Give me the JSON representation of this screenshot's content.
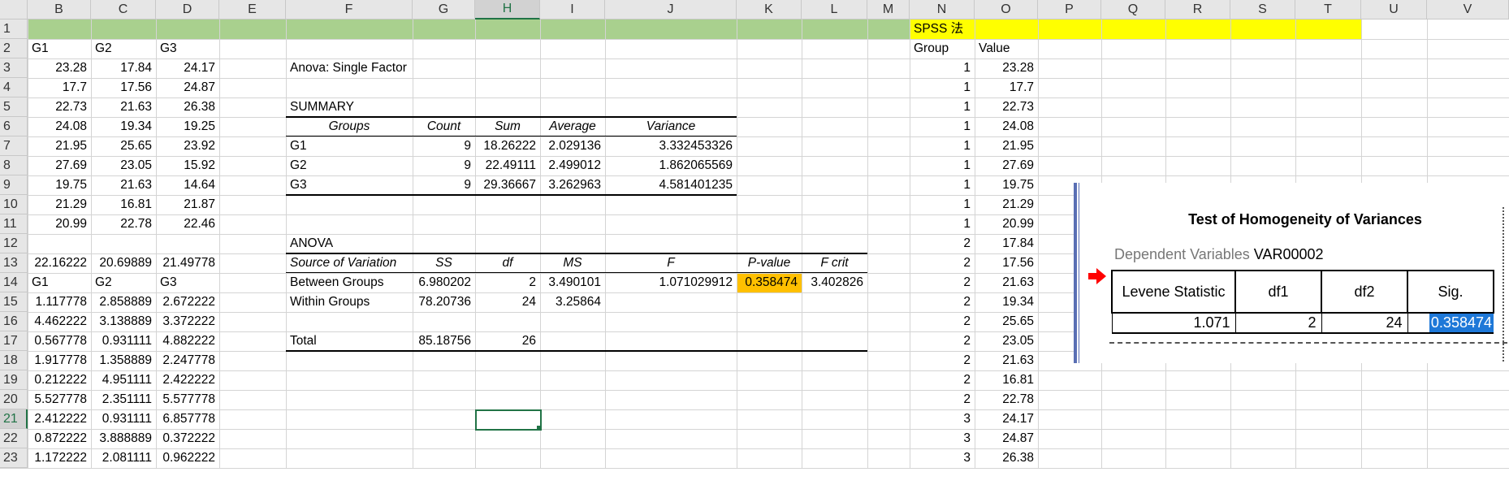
{
  "columns": [
    "B",
    "C",
    "D",
    "E",
    "F",
    "G",
    "H",
    "I",
    "J",
    "K",
    "L",
    "M",
    "N",
    "O",
    "P",
    "Q",
    "R",
    "S",
    "T",
    "U",
    "V"
  ],
  "rows": [
    "1",
    "2",
    "3",
    "4",
    "5",
    "6",
    "7",
    "8",
    "9",
    "10",
    "11",
    "12",
    "13",
    "14",
    "15",
    "16",
    "17",
    "18",
    "19",
    "20",
    "21",
    "22",
    "23"
  ],
  "colors": {
    "green_band": "#a9d08e",
    "yellow_band": "#ffff00",
    "pvalue_fill": "#ffc000",
    "selection": "#217346"
  },
  "cells": [
    [
      "N1",
      "SPSS 法",
      "l",
      ""
    ],
    [
      "B2",
      "G1",
      "l",
      ""
    ],
    [
      "C2",
      "G2",
      "l",
      ""
    ],
    [
      "D2",
      "G3",
      "l",
      ""
    ],
    [
      "N2",
      "Group",
      "l",
      ""
    ],
    [
      "O2",
      "Value",
      "l",
      ""
    ],
    [
      "B3",
      "23.28",
      "r",
      ""
    ],
    [
      "C3",
      "17.84",
      "r",
      ""
    ],
    [
      "D3",
      "24.17",
      "r",
      ""
    ],
    [
      "F3",
      "Anova: Single Factor",
      "l",
      ""
    ],
    [
      "B4",
      "17.7",
      "r",
      ""
    ],
    [
      "C4",
      "17.56",
      "r",
      ""
    ],
    [
      "D4",
      "24.87",
      "r",
      ""
    ],
    [
      "B5",
      "22.73",
      "r",
      ""
    ],
    [
      "C5",
      "21.63",
      "r",
      ""
    ],
    [
      "D5",
      "26.38",
      "r",
      ""
    ],
    [
      "F5",
      "SUMMARY",
      "l",
      ""
    ],
    [
      "B6",
      "24.08",
      "r",
      ""
    ],
    [
      "C6",
      "19.34",
      "r",
      ""
    ],
    [
      "D6",
      "19.25",
      "r",
      ""
    ],
    [
      "F6",
      "Groups",
      "c",
      "it"
    ],
    [
      "G6",
      "Count",
      "c",
      "it"
    ],
    [
      "H6",
      "Sum",
      "c",
      "it"
    ],
    [
      "I6",
      "Average",
      "c",
      "it"
    ],
    [
      "J6",
      "Variance",
      "c",
      "it"
    ],
    [
      "B7",
      "21.95",
      "r",
      ""
    ],
    [
      "C7",
      "25.65",
      "r",
      ""
    ],
    [
      "D7",
      "23.92",
      "r",
      ""
    ],
    [
      "F7",
      "G1",
      "l",
      ""
    ],
    [
      "G7",
      "9",
      "r",
      ""
    ],
    [
      "H7",
      "18.26222",
      "r",
      ""
    ],
    [
      "I7",
      "2.029136",
      "r",
      ""
    ],
    [
      "J7",
      "3.332453326",
      "r",
      ""
    ],
    [
      "B8",
      "27.69",
      "r",
      ""
    ],
    [
      "C8",
      "23.05",
      "r",
      ""
    ],
    [
      "D8",
      "15.92",
      "r",
      ""
    ],
    [
      "F8",
      "G2",
      "l",
      ""
    ],
    [
      "G8",
      "9",
      "r",
      ""
    ],
    [
      "H8",
      "22.49111",
      "r",
      ""
    ],
    [
      "I8",
      "2.499012",
      "r",
      ""
    ],
    [
      "J8",
      "1.862065569",
      "r",
      ""
    ],
    [
      "B9",
      "19.75",
      "r",
      ""
    ],
    [
      "C9",
      "21.63",
      "r",
      ""
    ],
    [
      "D9",
      "14.64",
      "r",
      ""
    ],
    [
      "F9",
      "G3",
      "l",
      ""
    ],
    [
      "G9",
      "9",
      "r",
      ""
    ],
    [
      "H9",
      "29.36667",
      "r",
      ""
    ],
    [
      "I9",
      "3.262963",
      "r",
      ""
    ],
    [
      "J9",
      "4.581401235",
      "r",
      ""
    ],
    [
      "B10",
      "21.29",
      "r",
      ""
    ],
    [
      "C10",
      "16.81",
      "r",
      ""
    ],
    [
      "D10",
      "21.87",
      "r",
      ""
    ],
    [
      "B11",
      "20.99",
      "r",
      ""
    ],
    [
      "C11",
      "22.78",
      "r",
      ""
    ],
    [
      "D11",
      "22.46",
      "r",
      ""
    ],
    [
      "F12",
      "ANOVA",
      "l",
      ""
    ],
    [
      "B13",
      "22.16222",
      "r",
      ""
    ],
    [
      "C13",
      "20.69889",
      "r",
      ""
    ],
    [
      "D13",
      "21.49778",
      "r",
      ""
    ],
    [
      "F13",
      "Source of Variation",
      "l",
      "it"
    ],
    [
      "G13",
      "SS",
      "c",
      "it"
    ],
    [
      "H13",
      "df",
      "c",
      "it"
    ],
    [
      "I13",
      "MS",
      "c",
      "it"
    ],
    [
      "J13",
      "F",
      "c",
      "it"
    ],
    [
      "K13",
      "P-value",
      "c",
      "it"
    ],
    [
      "L13",
      "F crit",
      "c",
      "it"
    ],
    [
      "B14",
      "G1",
      "l",
      ""
    ],
    [
      "C14",
      "G2",
      "l",
      ""
    ],
    [
      "D14",
      "G3",
      "l",
      ""
    ],
    [
      "F14",
      "Between Groups",
      "l",
      ""
    ],
    [
      "G14",
      "6.980202",
      "r",
      ""
    ],
    [
      "H14",
      "2",
      "r",
      ""
    ],
    [
      "I14",
      "3.490101",
      "r",
      ""
    ],
    [
      "J14",
      "1.071029912",
      "r",
      ""
    ],
    [
      "K14",
      "0.358474",
      "r",
      ""
    ],
    [
      "L14",
      "3.402826",
      "r",
      ""
    ],
    [
      "B15",
      "1.117778",
      "r",
      ""
    ],
    [
      "C15",
      "2.858889",
      "r",
      ""
    ],
    [
      "D15",
      "2.672222",
      "r",
      ""
    ],
    [
      "F15",
      "Within Groups",
      "l",
      ""
    ],
    [
      "G15",
      "78.20736",
      "r",
      ""
    ],
    [
      "H15",
      "24",
      "r",
      ""
    ],
    [
      "I15",
      "3.25864",
      "r",
      ""
    ],
    [
      "B16",
      "4.462222",
      "r",
      ""
    ],
    [
      "C16",
      "3.138889",
      "r",
      ""
    ],
    [
      "D16",
      "3.372222",
      "r",
      ""
    ],
    [
      "B17",
      "0.567778",
      "r",
      ""
    ],
    [
      "C17",
      "0.931111",
      "r",
      ""
    ],
    [
      "D17",
      "4.882222",
      "r",
      ""
    ],
    [
      "F17",
      "Total",
      "l",
      ""
    ],
    [
      "G17",
      "85.18756",
      "r",
      ""
    ],
    [
      "H17",
      "26",
      "r",
      ""
    ],
    [
      "B18",
      "1.917778",
      "r",
      ""
    ],
    [
      "C18",
      "1.358889",
      "r",
      ""
    ],
    [
      "D18",
      "2.247778",
      "r",
      ""
    ],
    [
      "B19",
      "0.212222",
      "r",
      ""
    ],
    [
      "C19",
      "4.951111",
      "r",
      ""
    ],
    [
      "D19",
      "2.422222",
      "r",
      ""
    ],
    [
      "B20",
      "5.527778",
      "r",
      ""
    ],
    [
      "C20",
      "2.351111",
      "r",
      ""
    ],
    [
      "D20",
      "5.577778",
      "r",
      ""
    ],
    [
      "B21",
      "2.412222",
      "r",
      ""
    ],
    [
      "C21",
      "0.931111",
      "r",
      ""
    ],
    [
      "D21",
      "6.857778",
      "r",
      ""
    ],
    [
      "B22",
      "0.872222",
      "r",
      ""
    ],
    [
      "C22",
      "3.888889",
      "r",
      ""
    ],
    [
      "D22",
      "0.372222",
      "r",
      ""
    ],
    [
      "B23",
      "1.172222",
      "r",
      ""
    ],
    [
      "C23",
      "2.081111",
      "r",
      ""
    ],
    [
      "D23",
      "0.962222",
      "r",
      ""
    ],
    [
      "N3",
      "1",
      "r",
      ""
    ],
    [
      "O3",
      "23.28",
      "r",
      ""
    ],
    [
      "N4",
      "1",
      "r",
      ""
    ],
    [
      "O4",
      "17.7",
      "r",
      ""
    ],
    [
      "N5",
      "1",
      "r",
      ""
    ],
    [
      "O5",
      "22.73",
      "r",
      ""
    ],
    [
      "N6",
      "1",
      "r",
      ""
    ],
    [
      "O6",
      "24.08",
      "r",
      ""
    ],
    [
      "N7",
      "1",
      "r",
      ""
    ],
    [
      "O7",
      "21.95",
      "r",
      ""
    ],
    [
      "N8",
      "1",
      "r",
      ""
    ],
    [
      "O8",
      "27.69",
      "r",
      ""
    ],
    [
      "N9",
      "1",
      "r",
      ""
    ],
    [
      "O9",
      "19.75",
      "r",
      ""
    ],
    [
      "N10",
      "1",
      "r",
      ""
    ],
    [
      "O10",
      "21.29",
      "r",
      ""
    ],
    [
      "N11",
      "1",
      "r",
      ""
    ],
    [
      "O11",
      "20.99",
      "r",
      ""
    ],
    [
      "N12",
      "2",
      "r",
      ""
    ],
    [
      "O12",
      "17.84",
      "r",
      ""
    ],
    [
      "N13",
      "2",
      "r",
      ""
    ],
    [
      "O13",
      "17.56",
      "r",
      ""
    ],
    [
      "N14",
      "2",
      "r",
      ""
    ],
    [
      "O14",
      "21.63",
      "r",
      ""
    ],
    [
      "N15",
      "2",
      "r",
      ""
    ],
    [
      "O15",
      "19.34",
      "r",
      ""
    ],
    [
      "N16",
      "2",
      "r",
      ""
    ],
    [
      "O16",
      "25.65",
      "r",
      ""
    ],
    [
      "N17",
      "2",
      "r",
      ""
    ],
    [
      "O17",
      "23.05",
      "r",
      ""
    ],
    [
      "N18",
      "2",
      "r",
      ""
    ],
    [
      "O18",
      "21.63",
      "r",
      ""
    ],
    [
      "N19",
      "2",
      "r",
      ""
    ],
    [
      "O19",
      "16.81",
      "r",
      ""
    ],
    [
      "N20",
      "2",
      "r",
      ""
    ],
    [
      "O20",
      "22.78",
      "r",
      ""
    ],
    [
      "N21",
      "3",
      "r",
      ""
    ],
    [
      "O21",
      "24.17",
      "r",
      ""
    ],
    [
      "N22",
      "3",
      "r",
      ""
    ],
    [
      "O22",
      "24.87",
      "r",
      ""
    ],
    [
      "N23",
      "3",
      "r",
      ""
    ],
    [
      "O23",
      "26.38",
      "r",
      ""
    ]
  ],
  "spss_output": {
    "title": "Test of Homogeneity of Variances",
    "dependent_label": "Dependent Variables",
    "dependent_value": "VAR00002",
    "headers": [
      "Levene Statistic",
      "df1",
      "df2",
      "Sig."
    ],
    "values": [
      "1.071",
      "2",
      "24",
      "0.358474"
    ],
    "arrow_icon": "red-arrow-icon"
  }
}
